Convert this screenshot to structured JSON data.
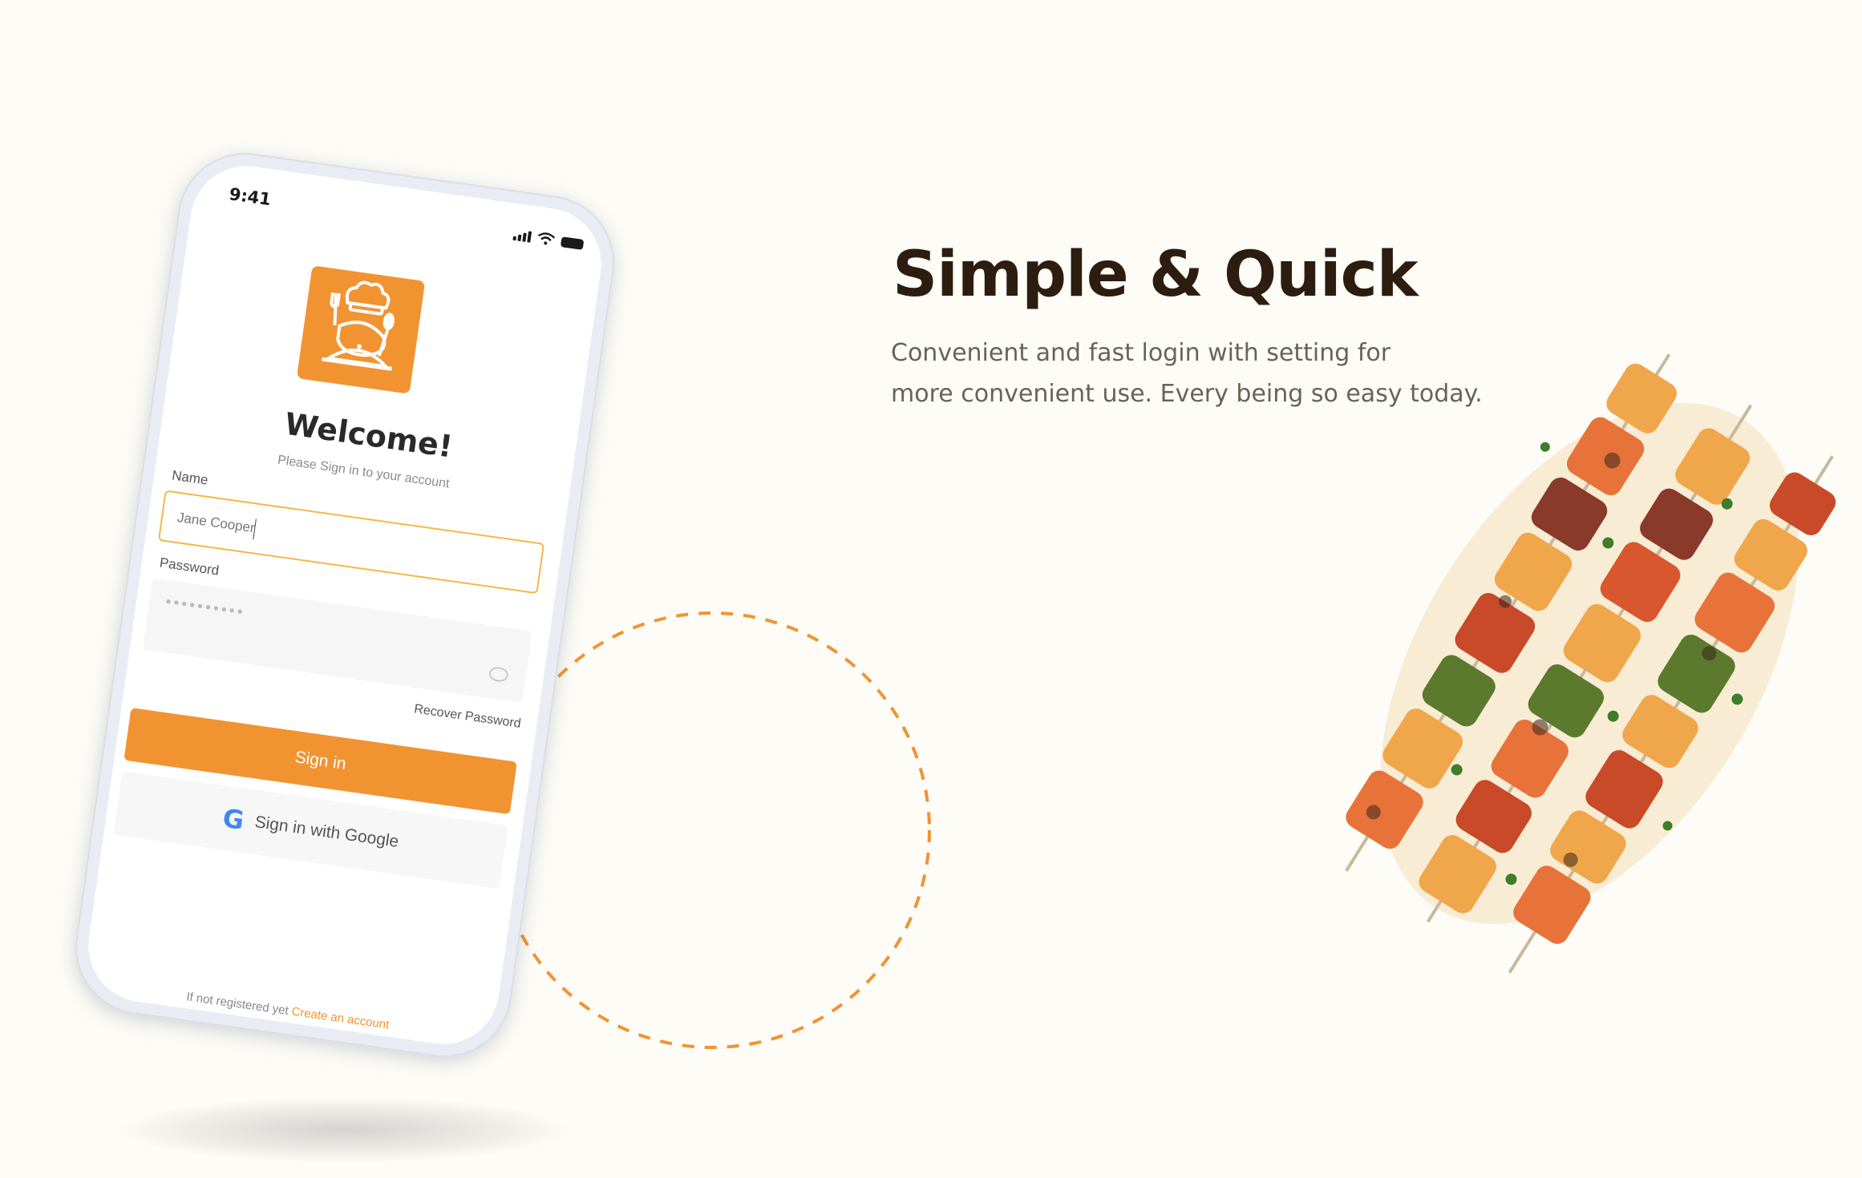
{
  "phone": {
    "status_time": "9:41",
    "welcome_title": "Welcome!",
    "subtitle": "Please Sign in to your account",
    "name_label": "Name",
    "name_value": "Jane Cooper",
    "password_label": "Password",
    "password_mask": "••••••••••",
    "recover_label": "Recover Password",
    "signin_label": "Sign in",
    "google_label": "Sign in with Google",
    "footer_text": "If not registered yet",
    "footer_link": "Create an account"
  },
  "hero": {
    "title": "Simple & Quick",
    "line1": "Convenient and fast login with setting for",
    "line2": "more convenient use. Every being so easy today."
  },
  "colors": {
    "accent": "#f29332",
    "background": "#fdfcf7",
    "headline": "#2c1d10",
    "input_border": "#f2b84b"
  },
  "icons": [
    "chef-logo-icon",
    "signal-icon",
    "wifi-icon",
    "battery-icon",
    "eye-off-icon",
    "google-icon"
  ]
}
